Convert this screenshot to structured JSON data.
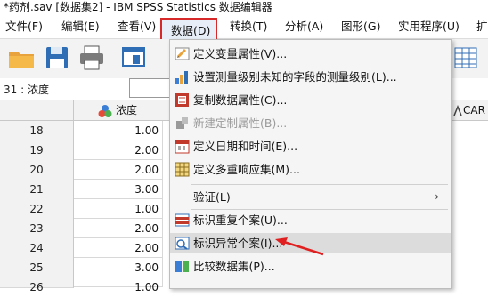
{
  "window": {
    "title": "*药剂.sav [数据集2] - IBM SPSS Statistics 数据编辑器"
  },
  "menubar": {
    "items": [
      "文件(F)",
      "编辑(E)",
      "查看(V)",
      "数据(D)",
      "转换(T)",
      "分析(A)",
      "图形(G)",
      "实用程序(U)",
      "扩"
    ],
    "active": "数据(D)"
  },
  "cellref": {
    "label": "31 : 浓度",
    "value": ""
  },
  "grid": {
    "col1_header": "浓度",
    "col2_header_partial": "CAR",
    "rows": [
      {
        "num": "18",
        "value": "1.00"
      },
      {
        "num": "19",
        "value": "2.00"
      },
      {
        "num": "20",
        "value": "2.00"
      },
      {
        "num": "21",
        "value": "3.00"
      },
      {
        "num": "22",
        "value": "1.00"
      },
      {
        "num": "23",
        "value": "2.00"
      },
      {
        "num": "24",
        "value": "2.00"
      },
      {
        "num": "25",
        "value": "3.00"
      },
      {
        "num": "26",
        "value": "1.00"
      }
    ]
  },
  "menu": {
    "items": [
      {
        "label": "定义变量属性(V)...",
        "icon": "define-variable-properties-icon",
        "disabled": false
      },
      {
        "label": "设置测量级别未知的字段的测量级别(L)...",
        "icon": "measurement-level-icon",
        "disabled": false
      },
      {
        "label": "复制数据属性(C)...",
        "icon": "copy-data-properties-icon",
        "disabled": false
      },
      {
        "label": "新建定制属性(B)...",
        "icon": "new-custom-attribute-icon",
        "disabled": true
      },
      {
        "label": "定义日期和时间(E)...",
        "icon": "calendar-icon",
        "disabled": false
      },
      {
        "label": "定义多重响应集(M)...",
        "icon": "multiple-response-icon",
        "disabled": false
      },
      {
        "label": "验证(L)",
        "icon": "",
        "disabled": false,
        "submenu": true
      },
      {
        "label": "标识重复个案(U)...",
        "icon": "duplicate-cases-icon",
        "disabled": false
      },
      {
        "label": "标识异常个案(I)...",
        "icon": "unusual-cases-icon",
        "disabled": false,
        "highlighted": true
      },
      {
        "label": "比较数据集(P)...",
        "icon": "compare-datasets-icon",
        "disabled": false
      }
    ],
    "submenu_arrow": "›"
  },
  "colors": {
    "highlight_box": "#d8292a",
    "arrow": "#e02020",
    "menu_hover": "#dcdcdc"
  }
}
